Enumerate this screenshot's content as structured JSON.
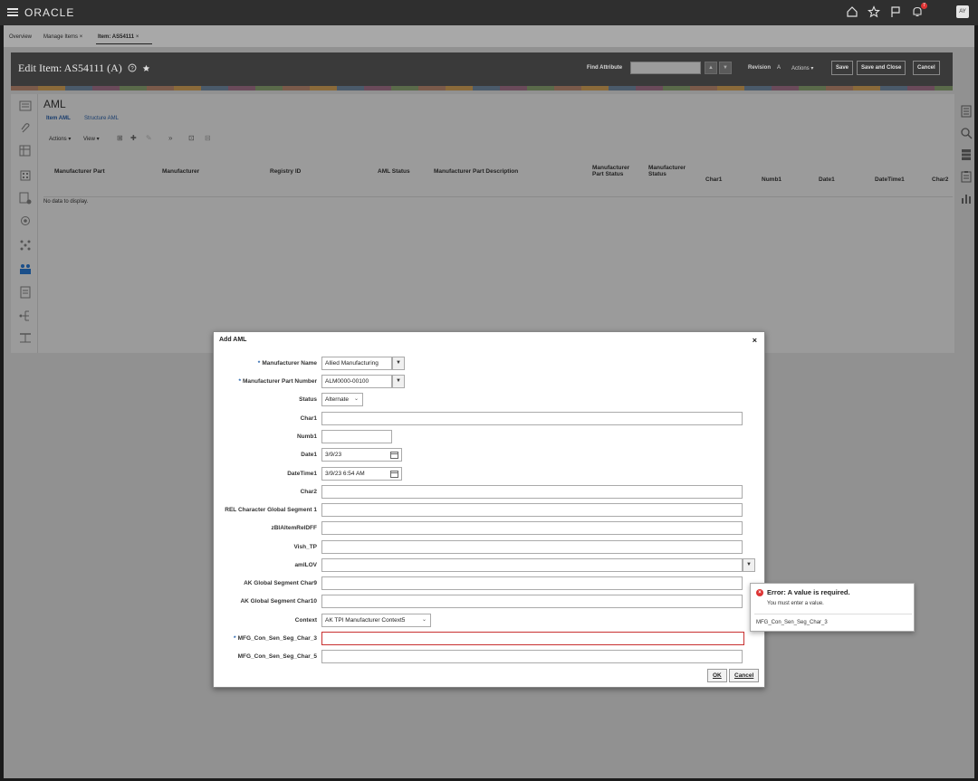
{
  "topbar": {
    "logo": "ORACLE",
    "avatar": "AY",
    "notification_count": "7"
  },
  "tabs": [
    {
      "label": "Overview"
    },
    {
      "label": "Manage Items",
      "close": "×"
    },
    {
      "label": "Item: AS54111",
      "close": "×"
    }
  ],
  "header": {
    "title": "Edit Item: AS54111 (A)",
    "find_attribute_label": "Find Attribute",
    "revision_label": "Revision",
    "revision_value": "A",
    "actions_label": "Actions",
    "save_label": "Save",
    "save_close_label": "Save and Close",
    "cancel_label": "Cancel"
  },
  "main": {
    "title": "AML",
    "subtabs": [
      "Item AML",
      "Structure AML"
    ],
    "toolbar": {
      "actions": "Actions",
      "view": "View"
    },
    "columns": [
      "Manufacturer Part",
      "Manufacturer",
      "Registry ID",
      "AML Status",
      "Manufacturer Part Description",
      "Manufacturer Part Status",
      "Manufacturer Status",
      "Char1",
      "Numb1",
      "Date1",
      "DateTime1",
      "Char2"
    ],
    "no_data": "No data to display."
  },
  "dialog": {
    "title": "Add AML",
    "close": "×",
    "fields": {
      "manufacturer_name": {
        "label": "Manufacturer Name",
        "value": "Allied Manufacturing"
      },
      "manufacturer_part_number": {
        "label": "Manufacturer Part Number",
        "value": "ALM0000-00100"
      },
      "status": {
        "label": "Status",
        "value": "Alternate"
      },
      "char1": {
        "label": "Char1",
        "value": ""
      },
      "numb1": {
        "label": "Numb1",
        "value": ""
      },
      "date1": {
        "label": "Date1",
        "value": "3/9/23"
      },
      "datetime1": {
        "label": "DateTime1",
        "value": "3/9/23 6:54 AM"
      },
      "char2": {
        "label": "Char2",
        "value": ""
      },
      "rel_char_global_seg1": {
        "label": "REL Character Global Segment 1",
        "value": ""
      },
      "zbi_item_rel_dff": {
        "label": "zBIAltemRelDFF",
        "value": ""
      },
      "vish_tp": {
        "label": "Vish_TP",
        "value": ""
      },
      "aml_lov": {
        "label": "amlLOV",
        "value": ""
      },
      "ak_global_char9": {
        "label": "AK Global Segment Char9",
        "value": ""
      },
      "ak_global_char10": {
        "label": "AK Global Segment Char10",
        "value": ""
      },
      "context": {
        "label": "Context",
        "value": "AK TPI Manufacturer Context5"
      },
      "mfg_char3": {
        "label": "MFG_Con_Sen_Seg_Char_3",
        "value": ""
      },
      "mfg_char5": {
        "label": "MFG_Con_Sen_Seg_Char_5",
        "value": ""
      }
    },
    "ok_label": "OK",
    "cancel_label": "Cancel"
  },
  "error": {
    "title": "Error: A value is required.",
    "message": "You must enter a value.",
    "field": "MFG_Con_Sen_Seg_Char_3"
  }
}
